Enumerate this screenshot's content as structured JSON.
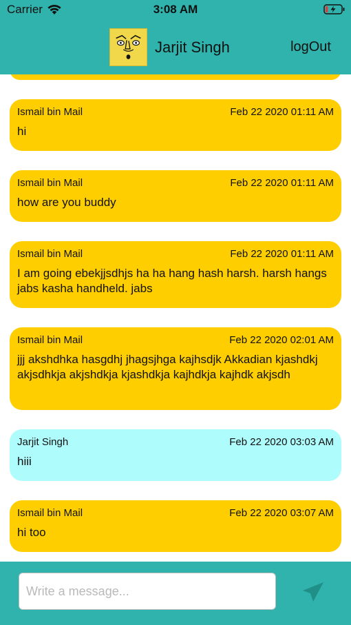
{
  "status_bar": {
    "carrier": "Carrier",
    "time": "3:08 AM",
    "icons": [
      "wifi-icon",
      "battery-charging-icon"
    ]
  },
  "nav": {
    "title": "Jarjit Singh",
    "avatar_icon": "cartoon-face-avatar",
    "logout_label": "logOut"
  },
  "messages": [
    {
      "sender": "Ismail bin Mail",
      "time": "Feb 22 2020 01:11 AM",
      "text": "hi",
      "type": "other"
    },
    {
      "sender": "Ismail bin Mail",
      "time": "Feb 22 2020 01:11 AM",
      "text": "how are you buddy",
      "type": "other"
    },
    {
      "sender": "Ismail bin Mail",
      "time": "Feb 22 2020 01:11 AM",
      "text": "I am going ebekjjsdhjs ha ha hang hash harsh. harsh hangs jabs kasha handheld. jabs",
      "type": "other"
    },
    {
      "sender": "Ismail bin Mail",
      "time": "Feb 22 2020 02:01 AM",
      "text": "jjj akshdhka hasgdhj jhagsjhga kajhsdjk Akkadian kjashdkj akjsdhkja akjshdkja kjashdkja kajhdkja kajhdk akjsdh",
      "type": "other"
    },
    {
      "sender": "Jarjit Singh",
      "time": "Feb 22 2020 03:03 AM",
      "text": "hiii",
      "type": "self"
    },
    {
      "sender": "Ismail bin Mail",
      "time": "Feb 22 2020 03:07 AM",
      "text": "hi too",
      "type": "other"
    }
  ],
  "composer": {
    "placeholder": "Write a message...",
    "value": "",
    "send_icon": "send-icon"
  },
  "colors": {
    "header_bg": "#2fb3ac",
    "incoming_bubble": "#fece00",
    "outgoing_bubble": "#aefcfc"
  }
}
